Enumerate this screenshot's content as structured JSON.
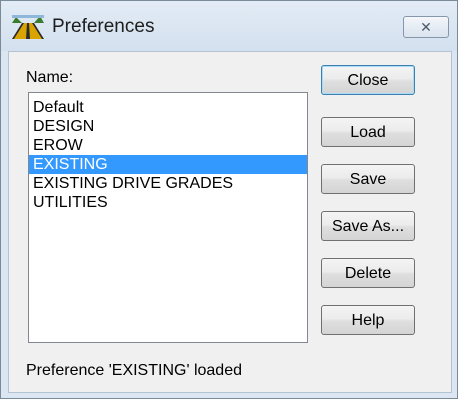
{
  "window": {
    "title": "Preferences",
    "close_glyph": "✕"
  },
  "form": {
    "name_label": "Name:"
  },
  "preferences": {
    "items": [
      "Default",
      "DESIGN",
      "EROW",
      "EXISTING",
      "EXISTING DRIVE GRADES",
      "UTILITIES"
    ],
    "selected_index": 3,
    "selected_color": "#3399ff"
  },
  "buttons": {
    "close": "Close",
    "load": "Load",
    "save": "Save",
    "save_as": "Save As...",
    "delete": "Delete",
    "help": "Help"
  },
  "status": {
    "text": "Preference 'EXISTING' loaded"
  }
}
